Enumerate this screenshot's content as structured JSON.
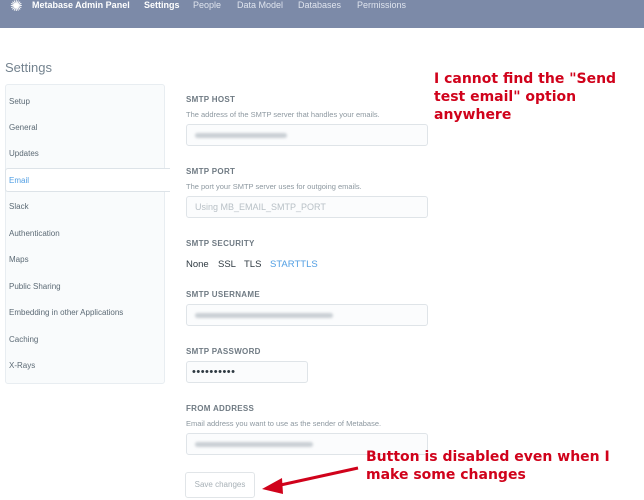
{
  "header": {
    "brand": "Metabase Admin Panel",
    "nav": [
      "Settings",
      "People",
      "Data Model",
      "Databases",
      "Permissions"
    ],
    "active_nav": "Settings"
  },
  "page_title": "Settings",
  "sidebar": {
    "items": [
      "Setup",
      "General",
      "Updates",
      "Email",
      "Slack",
      "Authentication",
      "Maps",
      "Public Sharing",
      "Embedding in other Applications",
      "Caching",
      "X-Rays"
    ],
    "active": "Email"
  },
  "form": {
    "smtp_host": {
      "label": "SMTP HOST",
      "description": "The address of the SMTP server that handles your emails."
    },
    "smtp_port": {
      "label": "SMTP PORT",
      "description": "The port your SMTP server uses for outgoing emails.",
      "placeholder": "Using MB_EMAIL_SMTP_PORT"
    },
    "smtp_security": {
      "label": "SMTP SECURITY",
      "options": [
        "None",
        "SSL",
        "TLS",
        "STARTTLS"
      ],
      "selected": "STARTTLS"
    },
    "smtp_username": {
      "label": "SMTP USERNAME"
    },
    "smtp_password": {
      "label": "SMTP PASSWORD",
      "value": "••••••••••"
    },
    "from_address": {
      "label": "FROM ADDRESS",
      "description": "Email address you want to use as the sender of Metabase."
    },
    "save_label": "Save changes"
  },
  "annotations": {
    "top": "I cannot find the \"Send test email\" option anywhere",
    "bottom": "Button is disabled even when I make some changes"
  },
  "colors": {
    "topbar": "#7c8aa8",
    "accent": "#509ee3",
    "annotation": "#d0021b"
  },
  "icons": {
    "logo": "gear-icon"
  }
}
